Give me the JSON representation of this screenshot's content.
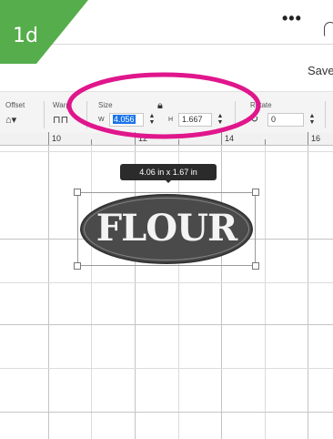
{
  "step": {
    "label": "1d",
    "color": "#4caf50"
  },
  "header": {
    "more_icon": "more-dots-icon",
    "more_glyph": "•••",
    "save_label": "Save"
  },
  "toolbar": {
    "offset_label": "Offset",
    "warp_label": "Warp",
    "size_label": "Size",
    "width_letter": "W",
    "width_value": "4.056",
    "height_letter": "H",
    "height_value": "1.667",
    "rotate_label": "Rotate",
    "rotate_value": "0"
  },
  "ruler": {
    "numbers": [
      "10",
      "12",
      "14",
      "16"
    ]
  },
  "canvas": {
    "dimension_tooltip": "4.06  in x 1.67  in",
    "label_text": "FLOUR"
  },
  "annotation": {
    "color": "#e0168c"
  }
}
